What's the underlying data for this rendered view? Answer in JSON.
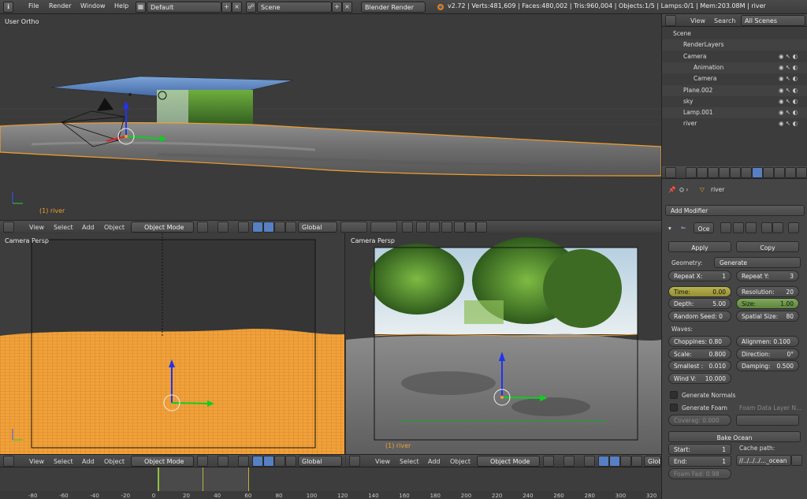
{
  "topbar": {
    "menus": [
      "File",
      "Render",
      "Window",
      "Help"
    ],
    "screen_layout": "Default",
    "scene": "Scene",
    "engine": "Blender Render",
    "stats": "v2.72 | Verts:481,609 | Faces:480,002 | Tris:960,004 | Objects:1/5 | Lamps:0/1 | Mem:203.08M | river"
  },
  "viewport_top": {
    "label": "User Ortho",
    "object_label": "(1) river"
  },
  "viewport_left": {
    "label": "Camera Persp"
  },
  "viewport_right": {
    "label": "Camera Persp",
    "object_label": "(1) river"
  },
  "view_header": {
    "view": "View",
    "select": "Select",
    "add": "Add",
    "object": "Object",
    "mode": "Object Mode",
    "orientation": "Global"
  },
  "outliner": {
    "view": "View",
    "search": "Search",
    "filter": "All Scenes",
    "items": [
      {
        "label": "Scene",
        "indent": 0
      },
      {
        "label": "RenderLayers",
        "indent": 1
      },
      {
        "label": "Camera",
        "indent": 1
      },
      {
        "label": "Animation",
        "indent": 2
      },
      {
        "label": "Camera",
        "indent": 2
      },
      {
        "label": "Plane.002",
        "indent": 1
      },
      {
        "label": "sky",
        "indent": 1
      },
      {
        "label": "Lamp.001",
        "indent": 1
      },
      {
        "label": "river",
        "indent": 1
      }
    ]
  },
  "properties": {
    "object_name": "river",
    "add_modifier": "Add Modifier",
    "modifier_name": "Oce",
    "apply": "Apply",
    "copy": "Copy",
    "geometry_label": "Geometry:",
    "geometry_value": "Generate",
    "repeat_x_label": "Repeat X:",
    "repeat_x": "1",
    "repeat_y_label": "Repeat Y:",
    "repeat_y": "3",
    "time_label": "Time:",
    "time": "0.00",
    "resolution_label": "Resolution:",
    "resolution": "20",
    "depth_label": "Depth:",
    "depth": "5.00",
    "size_label": "Size:",
    "size": "1.00",
    "random_seed_label": "Random Seed: 0",
    "spatial_size_label": "Spatial Size:",
    "spatial_size": "80",
    "waves_label": "Waves:",
    "choppiness_label": "Choppines: 0.80",
    "alignment_label": "Alignmen: 0.100",
    "scale_label": "Scale:",
    "scale": "0.800",
    "direction_label": "Direction:",
    "direction": "0°",
    "smallest_label": "Smallest :",
    "smallest": "0.010",
    "damping_label": "Damping:",
    "damping": "0.500",
    "wind_label": "Wind V:",
    "wind": "10.000",
    "generate_normals": "Generate Normals",
    "generate_foam": "Generate Foam",
    "foam_layer": "Foam Data Layer N...",
    "coverage_label": "Coverag: 0.000",
    "bake_ocean": "Bake Ocean",
    "start_label": "Start:",
    "start": "1",
    "end_label": "End:",
    "end": "1",
    "cache_path_label": "Cache path:",
    "cache_path": "//../../../..._ocean",
    "foam_fade": "Foam Fad: 0.98"
  },
  "timeline": {
    "ticks": [
      "-80",
      "-60",
      "-40",
      "-20",
      "0",
      "20",
      "40",
      "60",
      "80",
      "100",
      "120",
      "140",
      "160",
      "180",
      "200",
      "220",
      "240",
      "260",
      "280",
      "300",
      "320"
    ]
  },
  "colors": {
    "selection_orange": "#f0a030",
    "active_blue": "#5680c2",
    "time_yellow": "#b8b14e",
    "size_green": "#7fa85a"
  }
}
